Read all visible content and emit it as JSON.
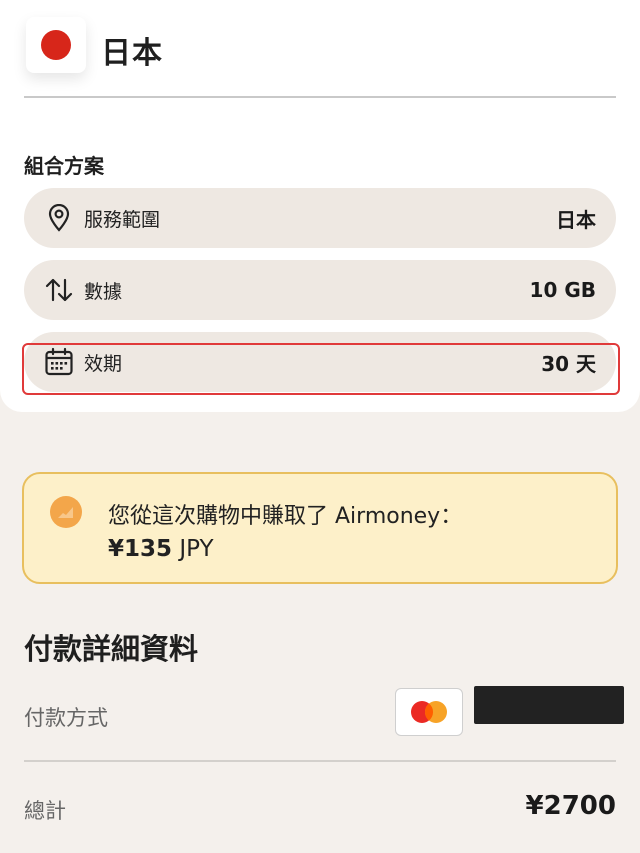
{
  "header": {
    "country": "日本",
    "flag_color": "#d7261a"
  },
  "plan": {
    "section_title": "組合方案",
    "rows": [
      {
        "icon": "location-pin-icon",
        "label": "服務範圍",
        "value": "日本"
      },
      {
        "icon": "up-down-arrows-icon",
        "label": "數據",
        "value": "10 GB"
      },
      {
        "icon": "calendar-icon",
        "label": "效期",
        "value": "30 天"
      }
    ]
  },
  "reward": {
    "text": "您從這次購物中賺取了 Airmoney：",
    "amount": "¥135",
    "currency": " JPY",
    "icon": "coin-icon"
  },
  "payment": {
    "title": "付款詳細資料",
    "method_label": "付款方式",
    "method_icon": "mastercard-icon",
    "total_label": "總計",
    "total_value": "¥2700"
  },
  "colors": {
    "highlight": "#e03a3a",
    "reward_bg": "#fdf0c9",
    "reward_border": "#e8bf5e"
  }
}
